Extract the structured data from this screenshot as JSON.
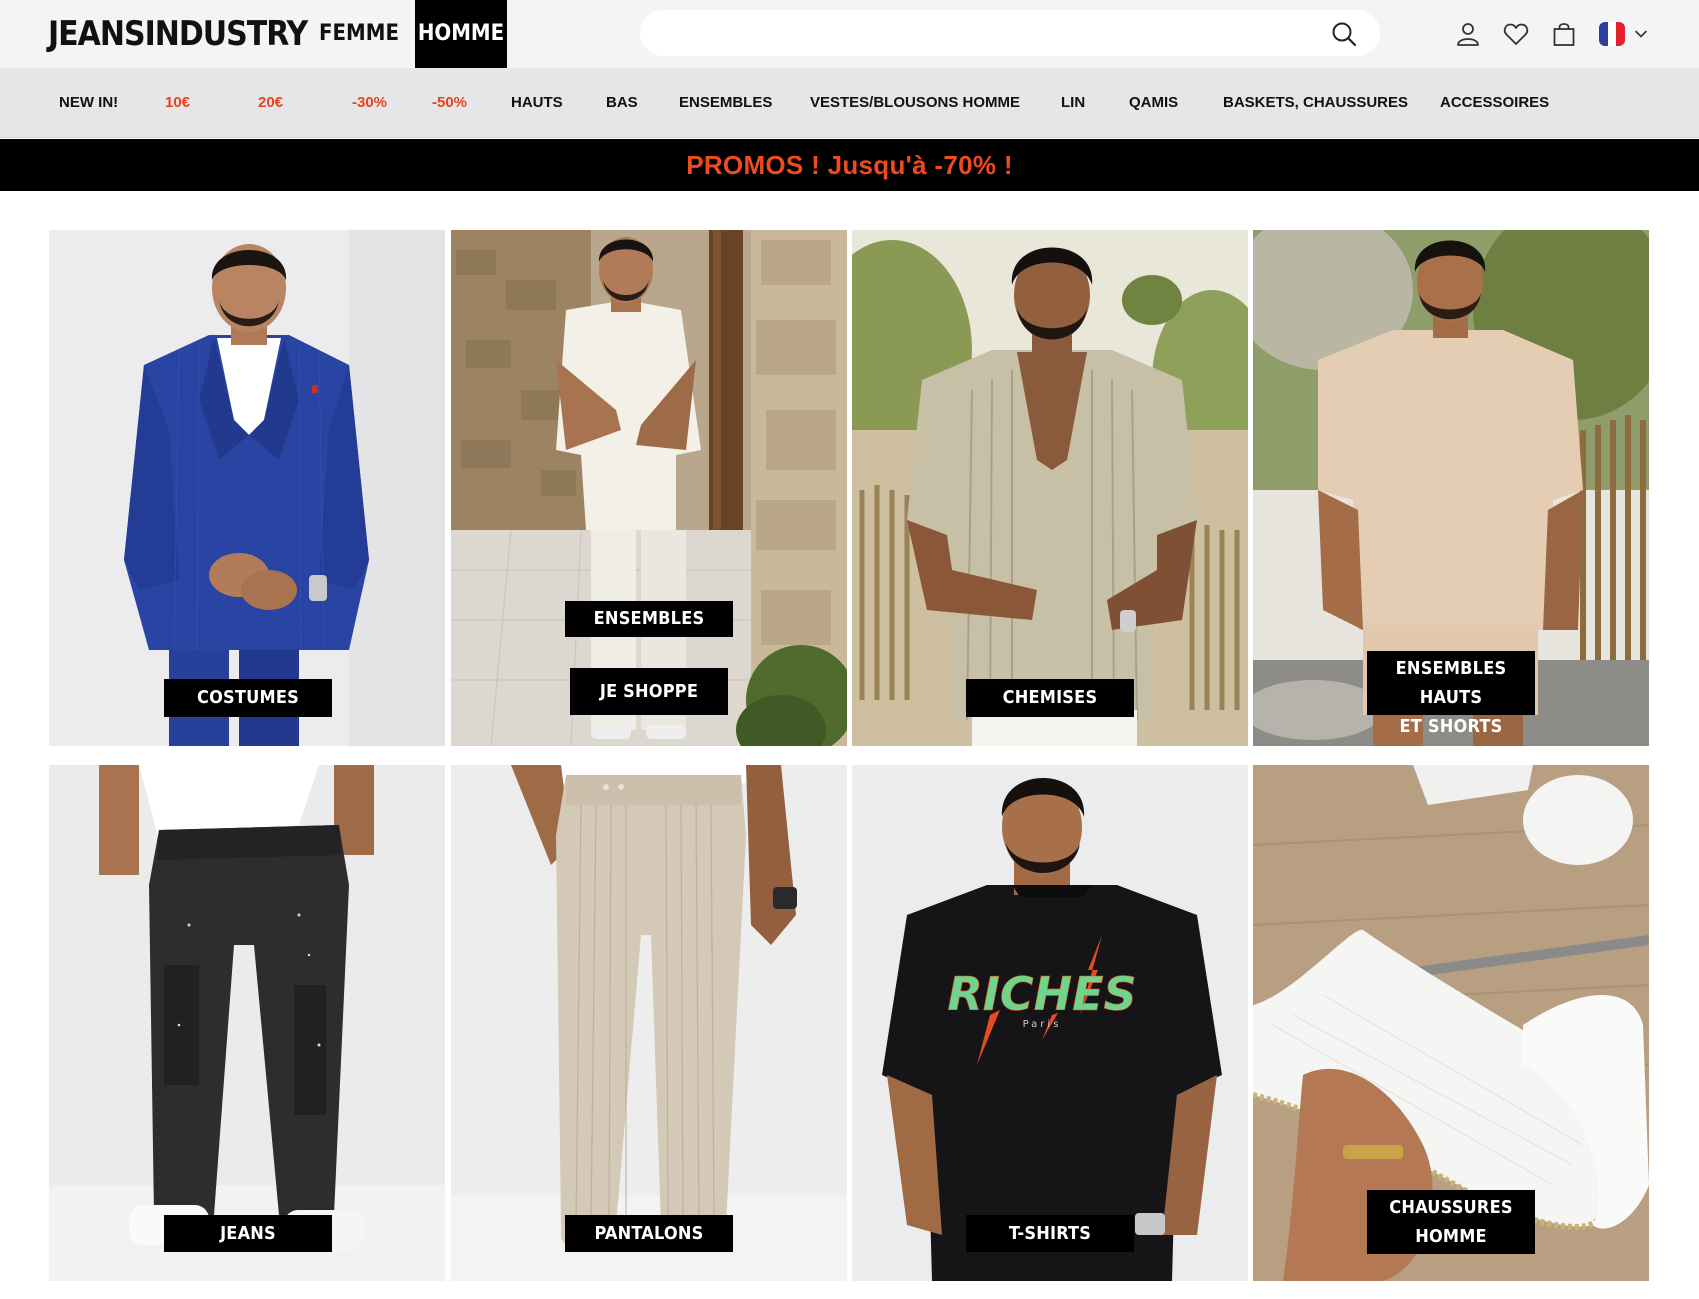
{
  "header": {
    "logo": "JEANSINDUSTRY",
    "tabs": [
      {
        "label": "FEMME",
        "active": false
      },
      {
        "label": "HOMME",
        "active": true
      }
    ],
    "search": {
      "value": "",
      "placeholder": ""
    },
    "icons": [
      "search-icon",
      "user-icon",
      "heart-icon",
      "shopping-bag-icon",
      "france-flag-icon",
      "chevron-down-icon"
    ]
  },
  "nav": {
    "items": [
      {
        "label": "NEW IN!",
        "promo": false
      },
      {
        "label": "10€",
        "promo": true
      },
      {
        "label": "20€",
        "promo": true
      },
      {
        "label": "-30%",
        "promo": true
      },
      {
        "label": "-50%",
        "promo": true
      },
      {
        "label": "HAUTS",
        "promo": false
      },
      {
        "label": "BAS",
        "promo": false
      },
      {
        "label": "ENSEMBLES",
        "promo": false
      },
      {
        "label": "VESTES/BLOUSONS HOMME",
        "promo": false
      },
      {
        "label": "LIN",
        "promo": false
      },
      {
        "label": "QAMIS",
        "promo": false
      },
      {
        "label": "BASKETS, CHAUSSURES",
        "promo": false
      },
      {
        "label": "ACCESSOIRES",
        "promo": false
      }
    ]
  },
  "promo_banner": {
    "text": "PROMOS ! Jusqu'à -70% !"
  },
  "colors": {
    "promo": "#e8431c",
    "banner_bg": "#000000",
    "nav_bg": "#e6e6e8",
    "header_bg": "#f4f4f6"
  },
  "grid": {
    "tiles": [
      {
        "labels": [
          "COSTUMES"
        ]
      },
      {
        "labels": [
          "ENSEMBLES",
          "JE SHOPPE"
        ]
      },
      {
        "labels": [
          "CHEMISES"
        ]
      },
      {
        "labels": [
          "ENSEMBLES HAUTS",
          "ET SHORTS"
        ]
      },
      {
        "labels": [
          "JEANS"
        ]
      },
      {
        "labels": [
          "PANTALONS"
        ]
      },
      {
        "labels": [
          "T-SHIRTS"
        ]
      },
      {
        "labels": [
          "CHAUSSURES",
          "HOMME"
        ]
      }
    ],
    "tshirt_print": {
      "main": "RICHES",
      "sub": "Paris"
    }
  }
}
